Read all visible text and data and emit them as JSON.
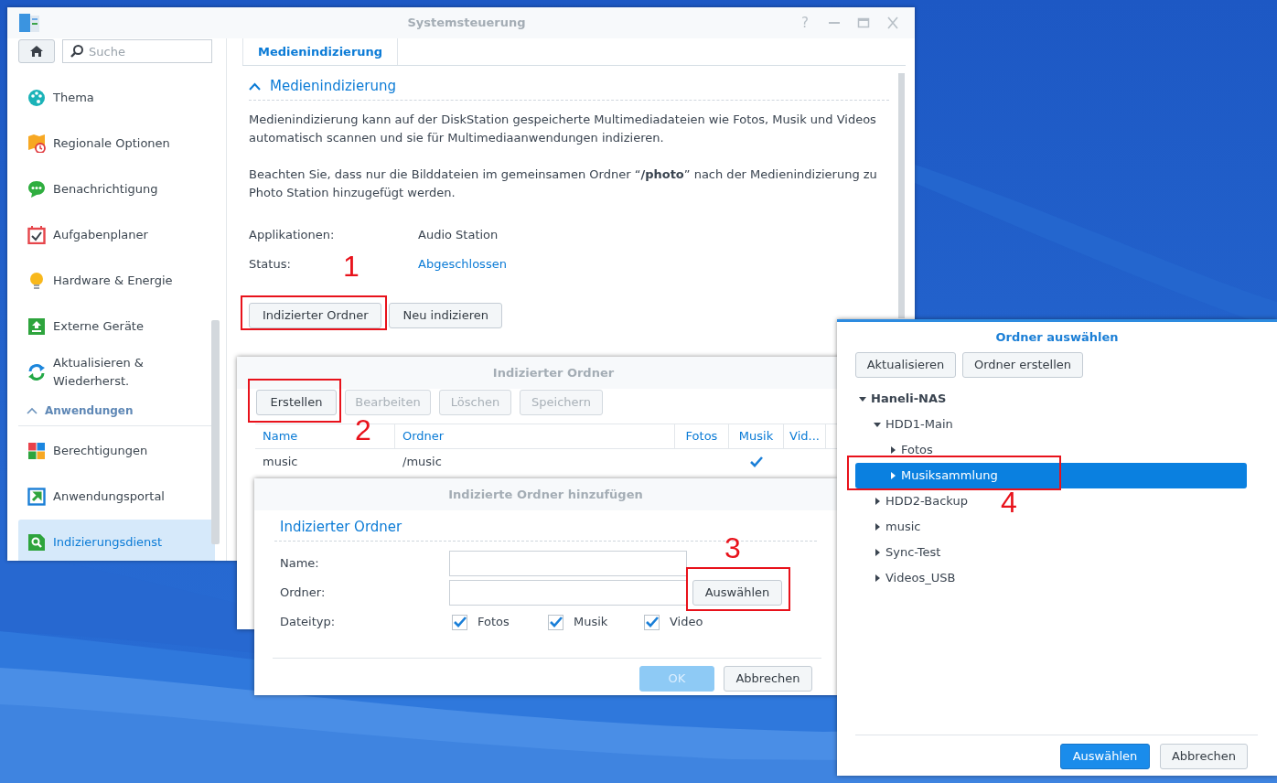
{
  "control_panel": {
    "title": "Systemsteuerung",
    "help_label": "?",
    "search": {
      "placeholder": "Suche"
    },
    "sidebar": {
      "items": [
        {
          "kind": "item",
          "label": "Thema",
          "selected": false
        },
        {
          "kind": "item",
          "label": "Regionale Optionen",
          "selected": false
        },
        {
          "kind": "item",
          "label": "Benachrichtigung",
          "selected": false
        },
        {
          "kind": "item",
          "label": "Aufgabenplaner",
          "selected": false
        },
        {
          "kind": "item",
          "label": "Hardware & Energie",
          "selected": false
        },
        {
          "kind": "item",
          "label": "Externe Geräte",
          "selected": false
        },
        {
          "kind": "item",
          "label": "Aktualisieren & Wiederherst.",
          "selected": false
        },
        {
          "kind": "section",
          "label": "Anwendungen",
          "expanded": true
        },
        {
          "kind": "item",
          "label": "Berechtigungen",
          "selected": false
        },
        {
          "kind": "item",
          "label": "Anwendungsportal",
          "selected": false
        },
        {
          "kind": "item",
          "label": "Indizierungsdienst",
          "selected": true
        }
      ]
    },
    "tabs": [
      {
        "label": "Medienindizierung",
        "selected": true
      }
    ],
    "section": {
      "title": "Medienindizierung",
      "expanded": true
    },
    "paragraphs": [
      "Medienindizierung kann auf der DiskStation gespeicherte Multimediadateien wie Fotos, Musik und Videos automatisch scannen und sie für Multimediaanwendungen indizieren.",
      "Beachten Sie, dass nur die Bilddateien im gemeinsamen Ordner “**/photo**” nach der Medienindizierung zu Photo Station hinzugefügt werden."
    ],
    "fields": [
      {
        "label": "Applikationen:",
        "value": "Audio Station",
        "kind": "text"
      },
      {
        "label": "Status:",
        "value": "Abgeschlossen",
        "kind": "link"
      }
    ],
    "buttons": [
      "Indizierter Ordner",
      "Neu indizieren"
    ]
  },
  "indexed_folders_dialog": {
    "title": "Indizierter Ordner",
    "buttons": [
      {
        "label": "Erstellen",
        "disabled": false
      },
      {
        "label": "Bearbeiten",
        "disabled": true
      },
      {
        "label": "Löschen",
        "disabled": true
      },
      {
        "label": "Speichern",
        "disabled": true
      }
    ],
    "table": {
      "columns": [
        "Name",
        "Ordner",
        "Fotos",
        "Musik",
        "Vid..."
      ],
      "rows": [
        {
          "name": "music",
          "folder": "/music",
          "fotos": false,
          "musik": true,
          "video": false
        }
      ]
    }
  },
  "add_dialog": {
    "title": "Indizierte Ordner hinzufügen",
    "section": "Indizierter Ordner",
    "name_label": "Name:",
    "folder_label": "Ordner:",
    "choose_button": "Auswählen",
    "filetype_label": "Dateityp:",
    "filetypes": [
      {
        "label": "Fotos",
        "checked": true
      },
      {
        "label": "Musik",
        "checked": true
      },
      {
        "label": "Video",
        "checked": true
      }
    ],
    "buttons": [
      {
        "label": "OK",
        "kind": "primary",
        "disabled": true
      },
      {
        "label": "Abbrechen",
        "kind": "default",
        "disabled": false
      }
    ]
  },
  "folder_dialog": {
    "title": "Ordner auswählen",
    "toolbar": [
      "Aktualisieren",
      "Ordner erstellen"
    ],
    "tree": [
      {
        "label": "Haneli-NAS",
        "expanded": true,
        "selected": false,
        "children": [
          {
            "label": "HDD1-Main",
            "expanded": true,
            "selected": false,
            "children": [
              {
                "label": "Fotos",
                "expanded": false,
                "selected": false
              },
              {
                "label": "Musiksammlung",
                "expanded": false,
                "selected": true
              }
            ]
          },
          {
            "label": "HDD2-Backup",
            "expanded": false,
            "selected": false
          },
          {
            "label": "music",
            "expanded": false,
            "selected": false
          },
          {
            "label": "Sync-Test",
            "expanded": false,
            "selected": false
          },
          {
            "label": "Videos_USB",
            "expanded": false,
            "selected": false
          }
        ]
      }
    ],
    "buttons": [
      {
        "label": "Auswählen",
        "kind": "primary",
        "disabled": false
      },
      {
        "label": "Abbrechen",
        "kind": "default",
        "disabled": false
      }
    ]
  },
  "annotations": [
    {
      "label": "1"
    },
    {
      "label": "2"
    },
    {
      "label": "3"
    },
    {
      "label": "4"
    }
  ]
}
